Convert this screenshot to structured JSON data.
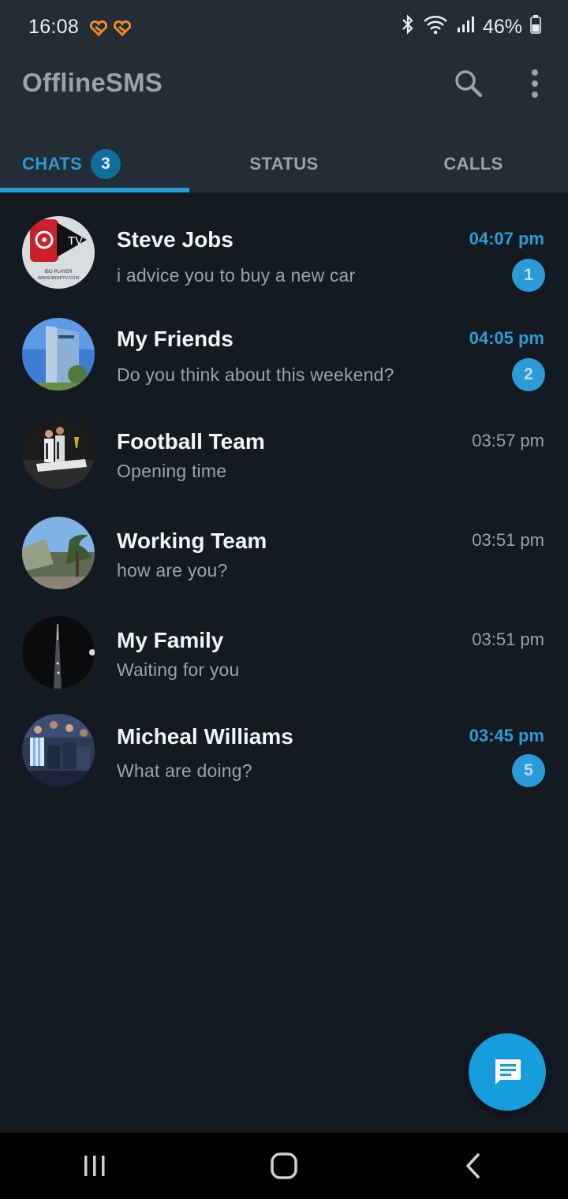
{
  "status_bar": {
    "time": "16:08",
    "battery": "46%",
    "icons": [
      "notification-heart-icon",
      "notification-heart-icon",
      "bluetooth-icon",
      "wifi-icon",
      "signal-icon",
      "battery-icon"
    ],
    "notification_color": "#f08a24"
  },
  "app": {
    "title": "OfflineSMS",
    "actions": [
      "search-icon",
      "more-vert-icon"
    ]
  },
  "tabs": [
    {
      "label": "CHATS",
      "count": "3",
      "active": true
    },
    {
      "label": "STATUS",
      "active": false
    },
    {
      "label": "CALLS",
      "active": false
    }
  ],
  "chats": [
    {
      "name": "Steve Jobs",
      "message": "i advice you to buy a new car",
      "time": "04:07 pm",
      "unread": "1"
    },
    {
      "name": "My Friends",
      "message": "Do you think about this weekend?",
      "time": "04:05 pm",
      "unread": "2"
    },
    {
      "name": "Football Team",
      "message": "Opening time",
      "time": "03:57 pm"
    },
    {
      "name": "Working Team",
      "message": "how are you?",
      "time": "03:51 pm"
    },
    {
      "name": "My Family",
      "message": "Waiting for you",
      "time": "03:51 pm"
    },
    {
      "name": "Micheal Williams",
      "message": "What are doing?",
      "time": "03:45 pm",
      "unread": "5"
    }
  ],
  "avatar_texts": {
    "iboplayer_1": "TV",
    "iboplayer_2": "IBO PLAYER",
    "iboplayer_3": "WWW.IBOIPTV.COM"
  },
  "fab": {
    "icon": "new-message-icon"
  },
  "nav_bar": {
    "buttons": [
      "recent-apps-icon",
      "home-icon",
      "back-icon"
    ]
  },
  "colors": {
    "accent": "#2a9bd7",
    "app_bar": "#232d36",
    "background": "#131a22",
    "muted_text": "#9aa3a9"
  }
}
